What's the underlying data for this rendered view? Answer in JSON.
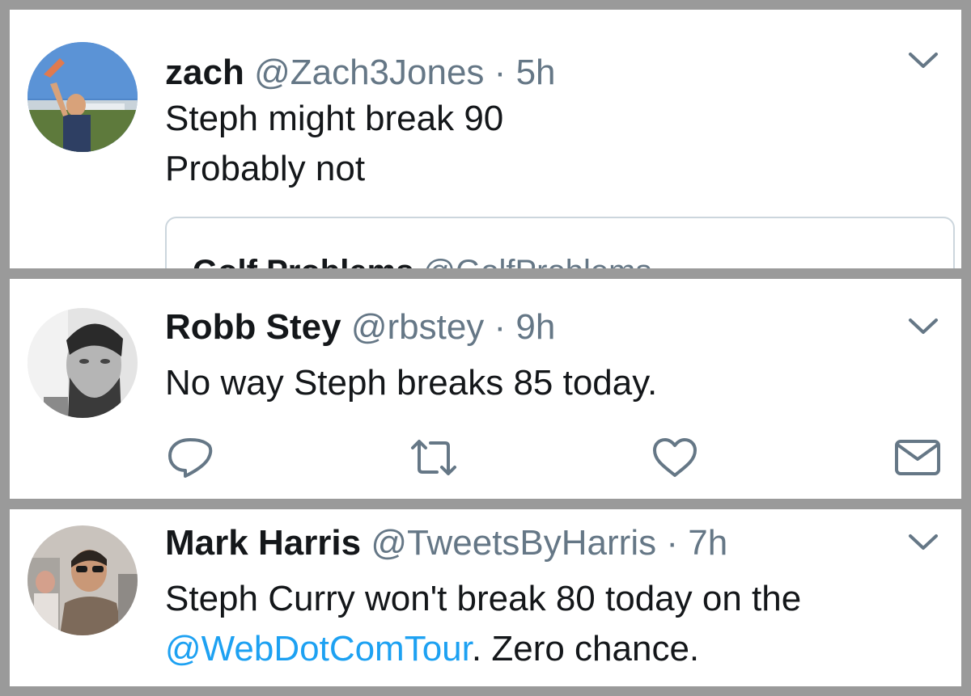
{
  "tweets": [
    {
      "name": "zach",
      "handle": "@Zach3Jones",
      "separator": "·",
      "time": "5h",
      "lines": [
        "Steph might break 90",
        "Probably not"
      ],
      "quoted": {
        "name": "Golf Problems",
        "handle": "@GolfProblems"
      }
    },
    {
      "name": "Robb Stey",
      "handle": "@rbstey",
      "separator": "·",
      "time": "9h",
      "lines": [
        "No way Steph breaks 85 today."
      ],
      "actions": [
        "reply-icon",
        "retweet-icon",
        "like-icon",
        "direct-message-icon"
      ]
    },
    {
      "name": "Mark Harris",
      "handle": "@TweetsByHarris",
      "separator": "·",
      "time": "7h",
      "line1": "Steph Curry won't break 80 today on the",
      "mention": "@WebDotComTour",
      "line2_rest": ". Zero chance."
    }
  ],
  "colors": {
    "background": "#9a9a9a",
    "text": "#14171a",
    "secondary": "#657786",
    "link": "#1da1f2",
    "border": "#ccd6dd"
  }
}
